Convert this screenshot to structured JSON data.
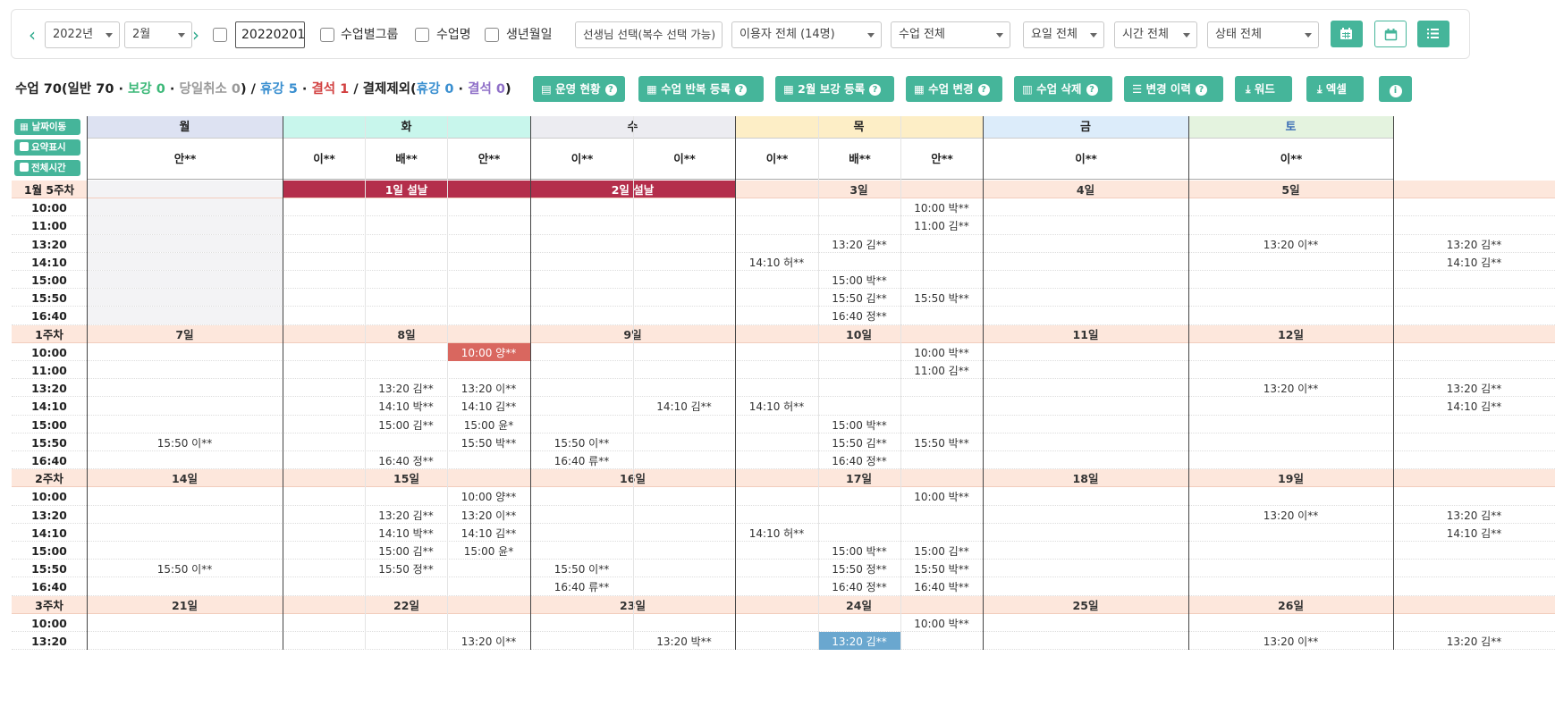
{
  "filters": {
    "year": "2022년",
    "month": "2월",
    "date_value": "20220201",
    "checkbox_class_group": "수업별그룹",
    "checkbox_class_name": "수업명",
    "checkbox_birth": "생년월일",
    "teacher_select": "선생님 선택(복수 선택 가능)",
    "user_select": "이용자 전체 (14명)",
    "class_select": "수업 전체",
    "weekday_select": "요일 전체",
    "time_select": "시간 전체",
    "status_select": "상태 전체",
    "prev_icon": "chevron-left-icon",
    "next_icon": "chevron-right-icon",
    "view_icons": [
      "calendar-icon",
      "calendar-outline-icon",
      "list-icon"
    ]
  },
  "summary": {
    "prefix": "수업 70(일반 70 · ",
    "makeup": "보강 0",
    "sep1": " · ",
    "same_day_cancel": "당일취소 0",
    "close1": ")  /  ",
    "holiday": "휴강 5",
    "sep2": " · ",
    "absent": "결석 1",
    "close2": "  /  결제제외(",
    "excl_holiday": "휴강 0",
    "sep3": " · ",
    "excl_absent": "결석 0",
    "close3": ")"
  },
  "toolbar": {
    "status_btn": "운영 현황",
    "repeat_btn": "수업 반복 등록",
    "makeup_btn": "2월 보강 등록",
    "change_btn": "수업 변경",
    "delete_btn": "수업 삭제",
    "history_btn": "변경 이력",
    "word_btn": "워드",
    "excel_btn": "엑셀",
    "help_mark": "?"
  },
  "side_buttons": {
    "date_move": "날짜이동",
    "summary_view": "요약표시",
    "all_time": "전체시간"
  },
  "colors": {
    "accent": "#45b59a",
    "holiday": "#b42e4b",
    "absent_cell": "#d9675f",
    "changed_cell": "#6aa7cf"
  },
  "calendar": {
    "days": [
      "월",
      "화",
      "수",
      "목",
      "금",
      "토"
    ],
    "teachers": {
      "mon": [
        "안**"
      ],
      "tue": [
        "이**",
        "배**",
        "안**"
      ],
      "wed": [
        "이**",
        "이**"
      ],
      "thu": [
        "이**",
        "배**",
        "안**"
      ],
      "fri": [
        "이**"
      ],
      "sat": [
        "이**"
      ]
    },
    "weeks": [
      {
        "label": "1월 5주차",
        "day_labels": [
          "",
          "1일 설날",
          "2일 설날",
          "3일",
          "4일",
          "5일"
        ],
        "times": [
          "10:00",
          "11:00",
          "13:20",
          "14:10",
          "15:00",
          "15:50",
          "16:40"
        ]
      },
      {
        "label": "1주차",
        "day_labels": [
          "7일",
          "8일",
          "9일",
          "10일",
          "11일",
          "12일"
        ],
        "times": [
          "10:00",
          "11:00",
          "13:20",
          "14:10",
          "15:00",
          "15:50",
          "16:40"
        ]
      },
      {
        "label": "2주차",
        "day_labels": [
          "14일",
          "15일",
          "16일",
          "17일",
          "18일",
          "19일"
        ],
        "times": [
          "10:00",
          "13:20",
          "14:10",
          "15:00",
          "15:50",
          "16:40"
        ]
      },
      {
        "label": "3주차",
        "day_labels": [
          "21일",
          "22일",
          "23일",
          "24일",
          "25일",
          "26일"
        ],
        "times": [
          "10:00",
          "13:20"
        ]
      }
    ],
    "entries": [
      {
        "row": 1,
        "col": 8,
        "text": "10:00 박**"
      },
      {
        "row": 2,
        "col": 8,
        "text": "11:00 김**"
      },
      {
        "row": 3,
        "col": 7,
        "text": "13:20 김**"
      },
      {
        "row": 3,
        "col": 10,
        "text": "13:20 이**"
      },
      {
        "row": 3,
        "col": 11,
        "text": "13:20 김**"
      },
      {
        "row": 4,
        "col": 6,
        "text": "14:10 허**"
      },
      {
        "row": 4,
        "col": 11,
        "text": "14:10 김**"
      },
      {
        "row": 5,
        "col": 7,
        "text": "15:00 박**"
      },
      {
        "row": 6,
        "col": 7,
        "text": "15:50 김**"
      },
      {
        "row": 6,
        "col": 8,
        "text": "15:50 박**"
      },
      {
        "row": 7,
        "col": 7,
        "text": "16:40 정**"
      },
      {
        "row": 9,
        "col": 3,
        "text": "10:00 양**",
        "style": "red"
      },
      {
        "row": 9,
        "col": 8,
        "text": "10:00 박**"
      },
      {
        "row": 10,
        "col": 8,
        "text": "11:00 김**"
      },
      {
        "row": 11,
        "col": 2,
        "text": "13:20 김**"
      },
      {
        "row": 11,
        "col": 3,
        "text": "13:20 이**"
      },
      {
        "row": 11,
        "col": 10,
        "text": "13:20 이**"
      },
      {
        "row": 11,
        "col": 11,
        "text": "13:20 김**"
      },
      {
        "row": 12,
        "col": 2,
        "text": "14:10 박**"
      },
      {
        "row": 12,
        "col": 3,
        "text": "14:10 김**"
      },
      {
        "row": 12,
        "col": 5,
        "text": "14:10 김**"
      },
      {
        "row": 12,
        "col": 6,
        "text": "14:10 허**"
      },
      {
        "row": 12,
        "col": 11,
        "text": "14:10 김**"
      },
      {
        "row": 13,
        "col": 2,
        "text": "15:00 김**"
      },
      {
        "row": 13,
        "col": 3,
        "text": "15:00 윤*"
      },
      {
        "row": 13,
        "col": 7,
        "text": "15:00 박**"
      },
      {
        "row": 14,
        "col": 0,
        "text": "15:50 이**"
      },
      {
        "row": 14,
        "col": 3,
        "text": "15:50 박**"
      },
      {
        "row": 14,
        "col": 4,
        "text": "15:50 이**"
      },
      {
        "row": 14,
        "col": 7,
        "text": "15:50 김**"
      },
      {
        "row": 14,
        "col": 8,
        "text": "15:50 박**"
      },
      {
        "row": 15,
        "col": 2,
        "text": "16:40 정**"
      },
      {
        "row": 15,
        "col": 4,
        "text": "16:40 류**"
      },
      {
        "row": 15,
        "col": 7,
        "text": "16:40 정**"
      },
      {
        "row": 17,
        "col": 3,
        "text": "10:00 양**"
      },
      {
        "row": 17,
        "col": 8,
        "text": "10:00 박**"
      },
      {
        "row": 18,
        "col": 2,
        "text": "13:20 김**"
      },
      {
        "row": 18,
        "col": 3,
        "text": "13:20 이**"
      },
      {
        "row": 18,
        "col": 10,
        "text": "13:20 이**"
      },
      {
        "row": 18,
        "col": 11,
        "text": "13:20 김**"
      },
      {
        "row": 19,
        "col": 2,
        "text": "14:10 박**"
      },
      {
        "row": 19,
        "col": 3,
        "text": "14:10 김**"
      },
      {
        "row": 19,
        "col": 6,
        "text": "14:10 허**"
      },
      {
        "row": 19,
        "col": 11,
        "text": "14:10 김**"
      },
      {
        "row": 20,
        "col": 2,
        "text": "15:00 김**"
      },
      {
        "row": 20,
        "col": 3,
        "text": "15:00 윤*"
      },
      {
        "row": 20,
        "col": 7,
        "text": "15:00 박**"
      },
      {
        "row": 20,
        "col": 8,
        "text": "15:00 김**"
      },
      {
        "row": 21,
        "col": 0,
        "text": "15:50 이**"
      },
      {
        "row": 21,
        "col": 2,
        "text": "15:50 정**"
      },
      {
        "row": 21,
        "col": 4,
        "text": "15:50 이**"
      },
      {
        "row": 21,
        "col": 7,
        "text": "15:50 정**"
      },
      {
        "row": 21,
        "col": 8,
        "text": "15:50 박**"
      },
      {
        "row": 22,
        "col": 4,
        "text": "16:40 류**"
      },
      {
        "row": 22,
        "col": 7,
        "text": "16:40 정**"
      },
      {
        "row": 22,
        "col": 8,
        "text": "16:40 박**"
      },
      {
        "row": 24,
        "col": 8,
        "text": "10:00 박**"
      },
      {
        "row": 25,
        "col": 3,
        "text": "13:20 이**"
      },
      {
        "row": 25,
        "col": 5,
        "text": "13:20 박**"
      },
      {
        "row": 25,
        "col": 7,
        "text": "13:20 김**",
        "style": "blue"
      },
      {
        "row": 25,
        "col": 10,
        "text": "13:20 이**"
      },
      {
        "row": 25,
        "col": 11,
        "text": "13:20 김**"
      }
    ]
  }
}
